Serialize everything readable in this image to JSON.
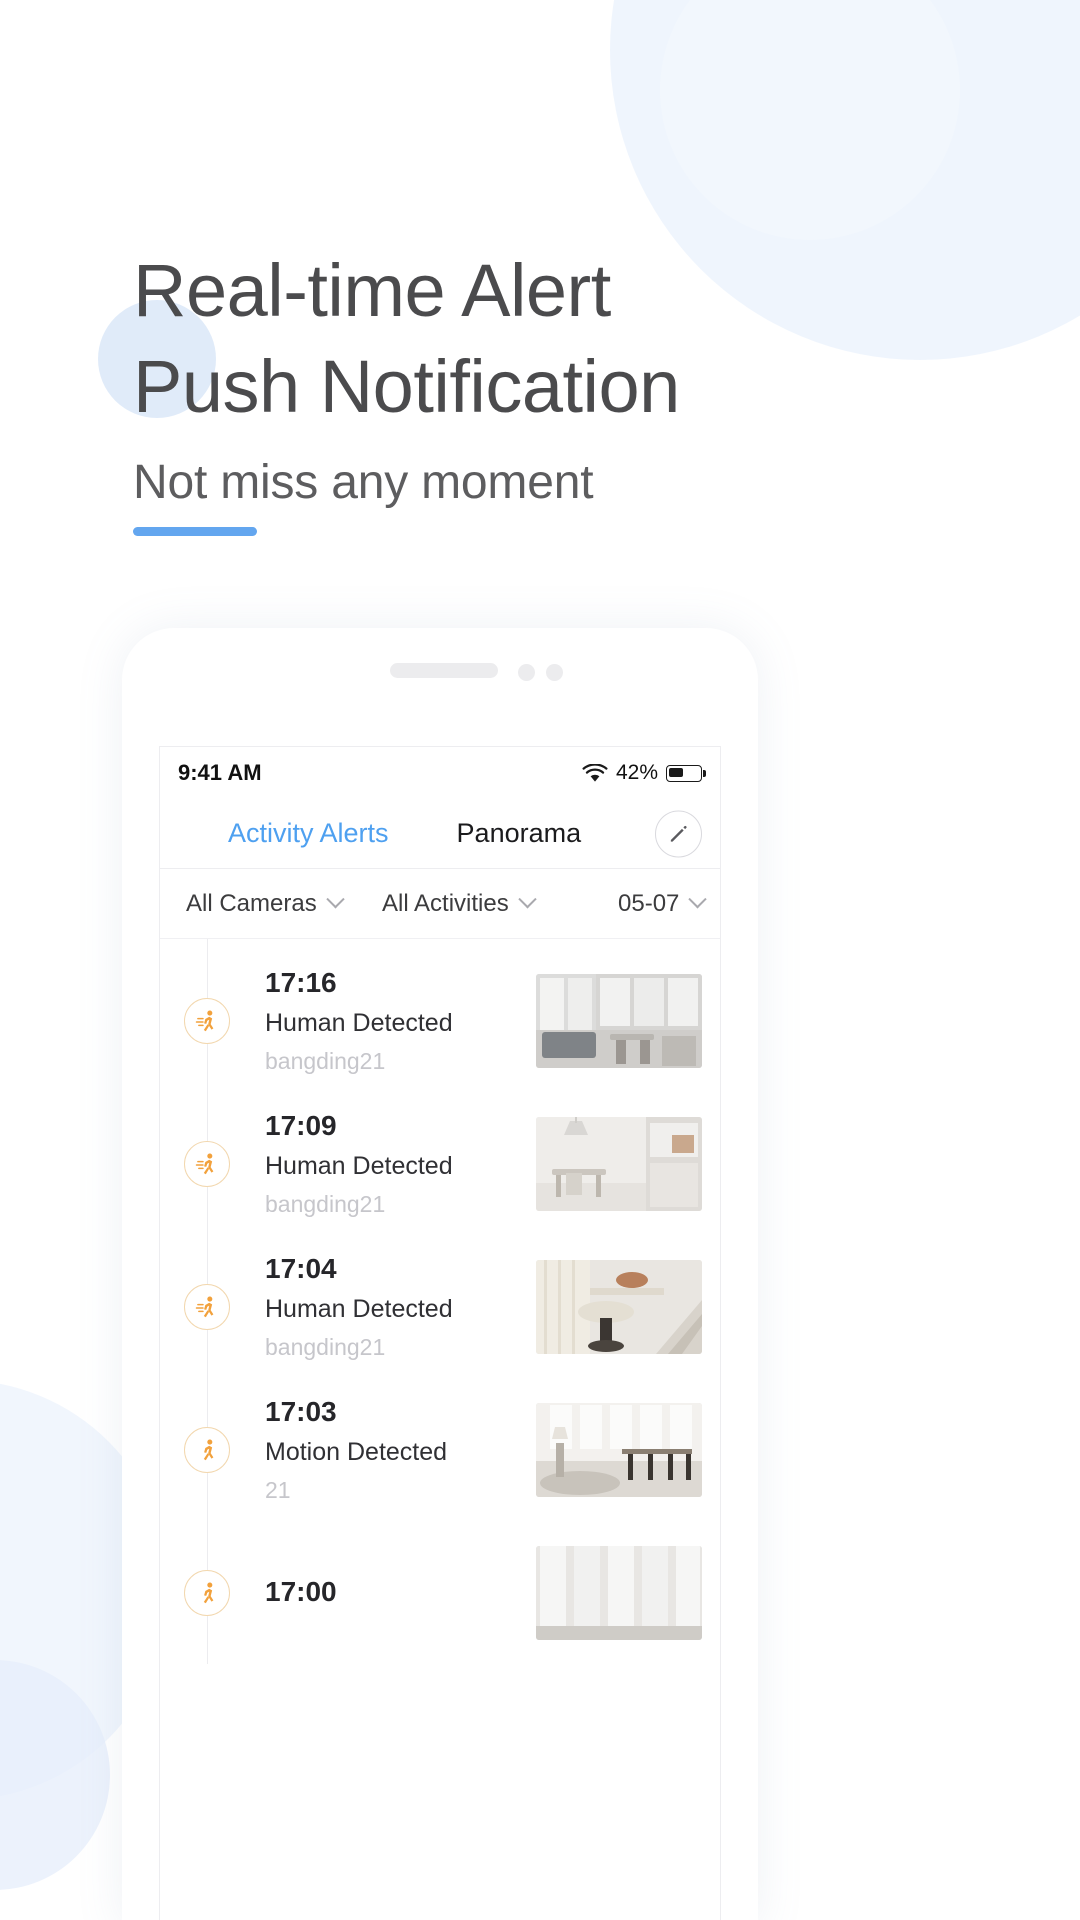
{
  "hero": {
    "title_line1": "Real-time Alert",
    "title_line2": "Push Notification",
    "subtitle": "Not miss any moment",
    "accent_color": "#63a6ef"
  },
  "phone": {
    "statusbar": {
      "time": "9:41 AM",
      "wifi_icon": "wifi-icon",
      "battery_percent": "42%",
      "battery_icon": "battery-icon"
    },
    "tabs": [
      {
        "label": "Activity Alerts",
        "active": true
      },
      {
        "label": "Panorama",
        "active": false
      }
    ],
    "edit_button": {
      "icon": "pencil-icon"
    },
    "filters": [
      {
        "label": "All Cameras",
        "icon": "chevron-down-icon"
      },
      {
        "label": "All Activities",
        "icon": "chevron-down-icon"
      },
      {
        "label": "05-07",
        "icon": "chevron-down-icon"
      }
    ],
    "alerts": [
      {
        "time": "17:16",
        "kind": "Human Detected",
        "camera": "bangding21",
        "icon": "human-walking-icon",
        "thumb": "living-room-windows"
      },
      {
        "time": "17:09",
        "kind": "Human Detected",
        "camera": "bangding21",
        "icon": "human-walking-icon",
        "thumb": "dining-room-lamp"
      },
      {
        "time": "17:04",
        "kind": "Human Detected",
        "camera": "bangding21",
        "icon": "human-walking-icon",
        "thumb": "round-table-shelf"
      },
      {
        "time": "17:03",
        "kind": "Motion Detected",
        "camera": "21",
        "icon": "human-walking-icon",
        "thumb": "loft-dining-table"
      },
      {
        "time": "17:00",
        "kind": "",
        "camera": "",
        "icon": "human-walking-icon",
        "thumb": "window-wall"
      }
    ]
  }
}
